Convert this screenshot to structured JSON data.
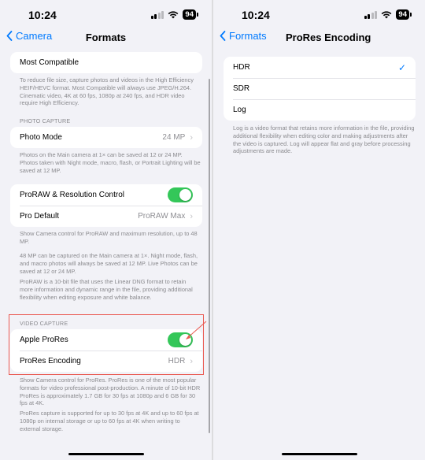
{
  "status": {
    "time": "10:24",
    "battery": "94"
  },
  "left": {
    "back_label": "Camera",
    "title": "Formats",
    "top_row": "Most Compatible",
    "top_footer": "To reduce file size, capture photos and videos in the High Efficiency HEIF/HEVC format. Most Compatible will always use JPEG/H.264. Cinematic video, 4K at 60 fps, 1080p at 240 fps, and HDR video require High Efficiency.",
    "photo_header": "PHOTO CAPTURE",
    "photo_mode_label": "Photo Mode",
    "photo_mode_value": "24 MP",
    "photo_footer": "Photos on the Main camera at 1× can be saved at 12 or 24 MP. Photos taken with Night mode, macro, flash, or Portrait Lighting will be saved at 12 MP.",
    "proraw_label": "ProRAW & Resolution Control",
    "pro_default_label": "Pro Default",
    "pro_default_value": "ProRAW Max",
    "proraw_footer_1": "Show Camera control for ProRAW and maximum resolution, up to 48 MP.",
    "proraw_footer_2": "48 MP can be captured on the Main camera at 1×. Night mode, flash, and macro photos will always be saved at 12 MP. Live Photos can be saved at 12 or 24 MP.",
    "proraw_footer_3": "ProRAW is a 10-bit file that uses the Linear DNG format to retain more information and dynamic range in the file, providing additional flexibility when editing exposure and white balance.",
    "video_header": "VIDEO CAPTURE",
    "apple_prores_label": "Apple ProRes",
    "prores_encoding_label": "ProRes Encoding",
    "prores_encoding_value": "HDR",
    "video_footer_1": "Show Camera control for ProRes. ProRes is one of the most popular formats for video professional post-production. A minute of 10-bit HDR ProRes is approximately 1.7 GB for 30 fps at 1080p and 6 GB for 30 fps at 4K.",
    "video_footer_2": "ProRes capture is supported for up to 30 fps at 4K and up to 60 fps at 1080p on internal storage or up to 60 fps at 4K when writing to external storage.",
    "toggles": {
      "proraw_on": true,
      "apple_prores_on": true
    }
  },
  "right": {
    "back_label": "Formats",
    "title": "ProRes Encoding",
    "options": [
      {
        "label": "HDR",
        "selected": true
      },
      {
        "label": "SDR",
        "selected": false
      },
      {
        "label": "Log",
        "selected": false
      }
    ],
    "footer": "Log is a video format that retains more information in the file, providing additional flexibility when editing color and making adjustments after the video is captured. Log will appear flat and gray before processing adjustments are made."
  },
  "colors": {
    "accent": "#007aff",
    "toggle_on": "#34c759",
    "highlight": "#ea5a52"
  },
  "icons": [
    "signal-icon",
    "wifi-icon",
    "battery-icon",
    "chevron-left-icon",
    "chevron-right-icon",
    "checkmark-icon"
  ]
}
